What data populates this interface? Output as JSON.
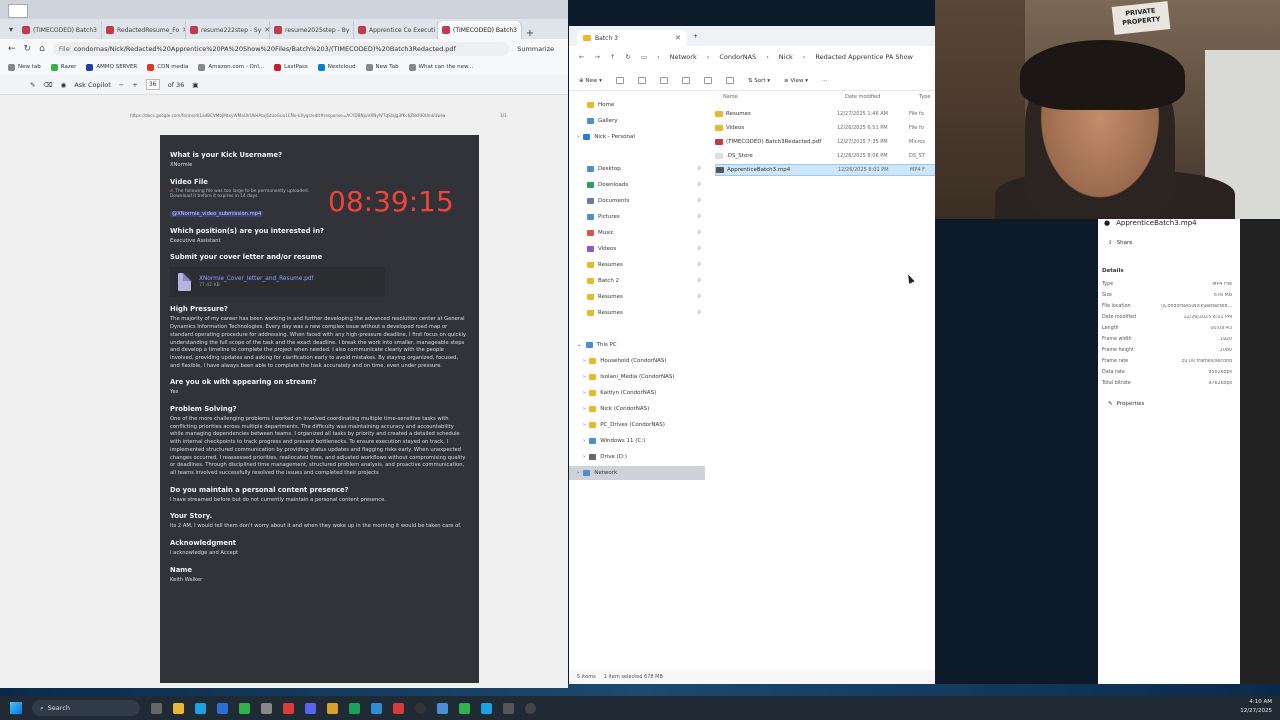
{
  "browser": {
    "tabs": [
      {
        "label": "(TIMECODED) Batch3",
        "active": false
      },
      {
        "label": "RedactedResume_Fo",
        "active": false
      },
      {
        "label": "resume222step - Sy",
        "active": false
      },
      {
        "label": "resume2025step - By",
        "active": false
      },
      {
        "label": "Apprentice Co Executi",
        "active": false
      },
      {
        "label": "(TIMECODED) Batch3",
        "active": true
      }
    ],
    "url_prefix": "File",
    "url": "condornas/Nick/Redacted%20Apprentice%20PA%20Show%20Files/Batch%203/(TIMECODED)%20Batch3Redacted.pdf",
    "summarize_label": "Summarize",
    "bookmarks": [
      "New tab",
      "Razer",
      "AMMO SERVER",
      "CDN media",
      "Amazon.com - Onl...",
      "LastPass",
      "Nextcloud",
      "New Tab",
      "What can the new..."
    ],
    "pdf_toolbar": {
      "ask_copilot": "Ask Copilot",
      "page_current": "36",
      "page_total": "of 36"
    }
  },
  "pdf": {
    "header_url": "https://docs.google.com/forms/d/1adBCVMbjMtxyWMaUIrUkHAtxJGtuoGuo1CNo-kXygc/edit#response=ACYDBNjuVXNyIVTqSlaJg3fKc6Z8sfd0UmkUwiw",
    "header_page": "1/1",
    "timer": "08:39:15",
    "q_username": "What is your Kick Username?",
    "a_username": "XNormie",
    "q_video": "Video File",
    "video_warn_1": "The following file was too large to be permanently uploaded.",
    "video_warn_2": "Download it before it expires in 14 days",
    "video_link": "@XNormie_video_submission.mp4",
    "q_position": "Which position(s) are you interested in?",
    "a_position": "Executive Assistant",
    "q_cover": "Submit your cover letter and/or resume",
    "attachment_name": "XNormie_Cover_letter_and_Resume.pdf",
    "attachment_size": "77.42 KB",
    "q_pressure": "High Pressure?",
    "a_pressure": "The majority of my career has been working in and further developing the advanced resolution center at General Dynamics Information Technologies. Every day was a new complex issue without a developed road map or standard operating procedure for addressing. When faced with any high-pressure deadline, I first focus on quickly understanding the full scope of the task and the exact deadline. I break the work into smaller, manageable steps and develop a timeline to complete the project when needed. I also communicate clearly with the people involved, providing updates and asking for clarification early to avoid mistakes. By staying organized, focused, and flexible, I have always been able to complete the task accurately and on time, even under pressure.",
    "q_stream": "Are you ok with appearing on stream?",
    "a_stream": "Yes",
    "q_problem": "Problem Solving?",
    "a_problem": "One of the more challenging problems I worked on involved coordinating multiple time-sensitive tasks with conflicting priorities across multiple departments. The difficulty was maintaining accuracy and accountability while managing dependencies between teams. I organized all tasks by priority and created a detailed schedule with internal checkpoints to track progress and prevent bottlenecks. To ensure execution stayed on track, I implemented structured communication by providing status updates and flagging risks early. When unexpected changes occurred, I reassessed priorities, reallocated time, and adjusted workflows without compromising quality or deadlines. Through disciplined time management, structured problem analysis, and proactive communication, all teams involved successfully resolved the issues and completed their projects",
    "q_content": "Do you maintain a personal content presence?",
    "a_content": "I have streamed before but do not currently maintain a personal content presence.",
    "q_story": "Your Story.",
    "a_story": "Its 2 AM, I would tell them don't worry about it and  when they woke up in the morning it would be taken care of.",
    "q_ack": "Acknowledgment",
    "a_ack": "I acknowledge and Accept",
    "q_name": "Name",
    "a_name": "Keith Walker"
  },
  "explorer": {
    "tab_title": "Batch 3",
    "breadcrumb": [
      "Network",
      "CondorNAS",
      "Nick",
      "Redacted Apprentice PA Show"
    ],
    "cmd": {
      "new": "New",
      "sort": "Sort",
      "view": "View"
    },
    "sidebar": [
      {
        "label": "Home",
        "color": "#e8b830"
      },
      {
        "label": "Gallery",
        "color": "#4a8fd6"
      },
      {
        "label": "Nick - Personal",
        "color": "#2a7fd4"
      },
      {
        "label": "Desktop",
        "color": "#4a8fd6"
      },
      {
        "label": "Downloads",
        "color": "#2f9e57"
      },
      {
        "label": "Documents",
        "color": "#6a7fa0"
      },
      {
        "label": "Pictures",
        "color": "#4a8fd6"
      },
      {
        "label": "Music",
        "color": "#d65a4a"
      },
      {
        "label": "Videos",
        "color": "#8a5ad6"
      },
      {
        "label": "Resumes",
        "color": "#e8b830"
      },
      {
        "label": "Batch 2",
        "color": "#e8b830"
      },
      {
        "label": "Resumes",
        "color": "#e8b830"
      },
      {
        "label": "Resumes",
        "color": "#e8b830"
      },
      {
        "label": "This PC",
        "color": "#4a8fd6"
      },
      {
        "label": "Household (CondorNAS)",
        "color": "#e8b830"
      },
      {
        "label": "Isolani_Media (CondorNAS)",
        "color": "#e8b830"
      },
      {
        "label": "Kaitlyn (CondorNAS)",
        "color": "#e8b830"
      },
      {
        "label": "Nick (CondorNAS)",
        "color": "#e8b830"
      },
      {
        "label": "PC_Drives (CondorNAS)",
        "color": "#e8b830"
      },
      {
        "label": "Windows 11 (C:)",
        "color": "#4a8fd6"
      },
      {
        "label": "Drive (D:)",
        "color": "#666666"
      },
      {
        "label": "Network",
        "color": "#4a8fd6"
      }
    ],
    "columns": {
      "name": "Name",
      "date": "Date modified",
      "type": "Type"
    },
    "files": [
      {
        "name": "Resumes",
        "date": "12/27/2025 1:46 AM",
        "type": "File fo"
      },
      {
        "name": "Videos",
        "date": "12/26/2025 6:51 PM",
        "type": "File fo"
      },
      {
        "name": "(TIMECODED) Batch3Redacted.pdf",
        "date": "12/27/2025 7:35 PM",
        "type": "Micros"
      },
      {
        "name": ".DS_Store",
        "date": "12/26/2025 8:06 PM",
        "type": "DS_ST"
      },
      {
        "name": "ApprenticeBatch3.mp4",
        "date": "12/26/2025 8:01 PM",
        "type": "MP4 F"
      }
    ],
    "status_items": "5 items",
    "status_selected": "1 item selected  678 MB"
  },
  "webcam": {
    "sign": "PRIVATE PROPERTY"
  },
  "details": {
    "title": "ApprenticeBatch3.mp4",
    "share": "Share",
    "header": "Details",
    "rows": [
      {
        "k": "Type",
        "v": "MP4 File"
      },
      {
        "k": "Size",
        "v": "678 MB"
      },
      {
        "k": "File location",
        "v": "\\\\CondorNAS\\Nick\\Redacted..."
      },
      {
        "k": "Date modified",
        "v": "12/26/2025 8:01 PM"
      },
      {
        "k": "Length",
        "v": "00:09:43"
      },
      {
        "k": "Frame width",
        "v": "1920"
      },
      {
        "k": "Frame height",
        "v": "1080"
      },
      {
        "k": "Frame rate",
        "v": "30.00 frames/second"
      },
      {
        "k": "Data rate",
        "v": "9582kbps"
      },
      {
        "k": "Total bitrate",
        "v": "9762kbps"
      }
    ],
    "properties": "Properties"
  },
  "taskbar": {
    "search": "Search",
    "time": "4:10 AM",
    "date": "12/27/2025"
  }
}
